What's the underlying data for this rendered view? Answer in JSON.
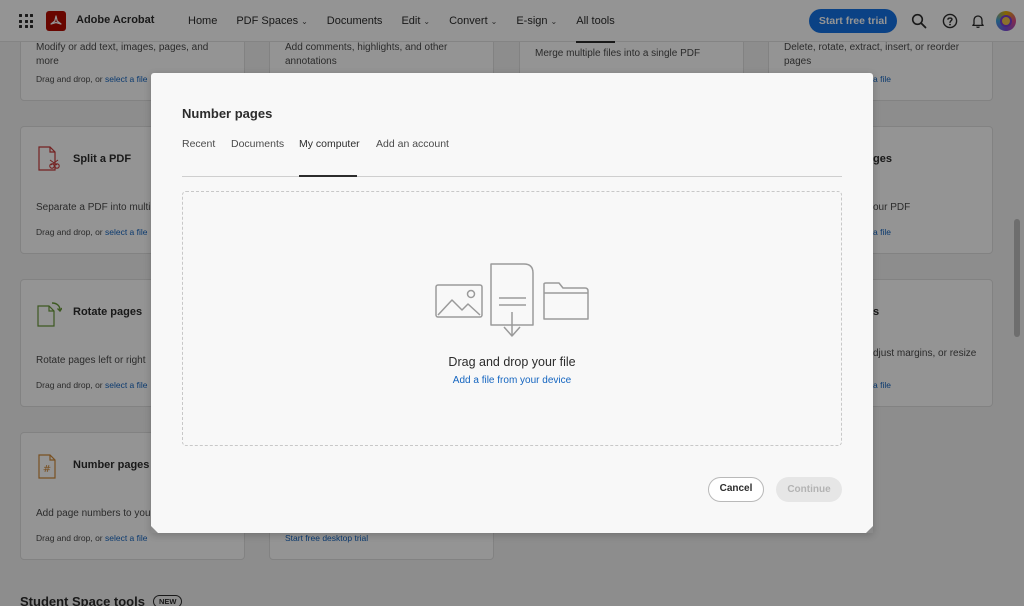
{
  "app": {
    "name": "Adobe Acrobat"
  },
  "nav": [
    {
      "label": "Home",
      "dropdown": false,
      "active": false
    },
    {
      "label": "PDF Spaces",
      "dropdown": true,
      "active": false
    },
    {
      "label": "Documents",
      "dropdown": false,
      "active": false
    },
    {
      "label": "Edit",
      "dropdown": true,
      "active": false
    },
    {
      "label": "Convert",
      "dropdown": true,
      "active": false
    },
    {
      "label": "E-sign",
      "dropdown": true,
      "active": false
    },
    {
      "label": "All tools",
      "dropdown": false,
      "active": true
    }
  ],
  "header": {
    "trial_button": "Start free trial",
    "icons": [
      "search-icon",
      "help-icon",
      "notifications-icon",
      "avatar"
    ]
  },
  "cards": {
    "edit": {
      "desc": "Modify or add text, images, pages, and more",
      "foot_prefix": "Drag and drop, or ",
      "foot_link": "select a file"
    },
    "comment": {
      "desc": "Add comments, highlights, and other annotations"
    },
    "combine": {
      "desc": "Merge multiple files into a single PDF"
    },
    "organize": {
      "desc": "Delete, rotate, extract, insert, or reorder pages",
      "foot_link": "a file"
    },
    "split": {
      "title": "Split a PDF",
      "desc": "Separate a PDF into multip",
      "foot_prefix": "Drag and drop, or ",
      "foot_link": "select a file"
    },
    "insert": {
      "title": "ges",
      "desc": "our PDF",
      "foot_link": "a file"
    },
    "rotate": {
      "title": "Rotate pages",
      "desc": "Rotate pages left or right",
      "foot_prefix": "Drag and drop, or ",
      "foot_link": "select a file"
    },
    "crop": {
      "title": "s",
      "desc": "djust margins, or resize",
      "foot_link": "a file"
    },
    "number": {
      "title": "Number pages",
      "desc": "Add page numbers to your",
      "foot_prefix": "Drag and drop, or ",
      "foot_link": "select a file"
    },
    "desktop": {
      "foot_link": "Start free desktop trial"
    }
  },
  "section": {
    "title": "Student Space tools",
    "badge": "NEW"
  },
  "modal": {
    "title": "Number pages",
    "tabs": [
      {
        "label": "Recent",
        "selected": false
      },
      {
        "label": "Documents",
        "selected": false
      },
      {
        "label": "My computer",
        "selected": true
      },
      {
        "label": "Add an account",
        "selected": false
      }
    ],
    "dropzone": {
      "title": "Drag and drop your file",
      "link": "Add a file from your device"
    },
    "cancel": "Cancel",
    "continue": "Continue"
  },
  "colors": {
    "accent": "#1473e6",
    "link": "#1465c0",
    "brand": "#b30b00"
  }
}
